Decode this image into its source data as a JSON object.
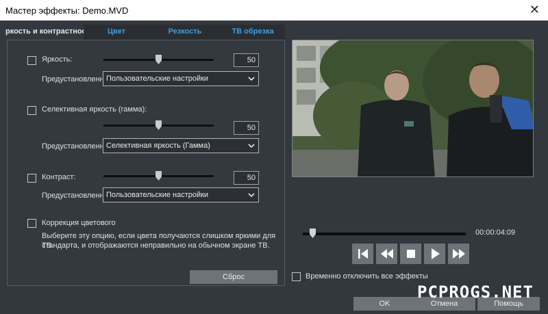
{
  "window": {
    "title": "Мастер эффекты: Demo.MVD",
    "close_glyph": "✕"
  },
  "tabs": [
    {
      "label": "ркость и контрастнос",
      "active": true
    },
    {
      "label": "Цвет"
    },
    {
      "label": "Резкость"
    },
    {
      "label": "ТВ обрезка"
    }
  ],
  "brightness": {
    "label": "Яркость:",
    "checked": false,
    "value": "50",
    "slider_value": 50,
    "preset_label": "Предустановленна",
    "preset_value": "Пользовательские настройки"
  },
  "gamma": {
    "label": "Селективная яркость (гамма):",
    "checked": false,
    "value": "50",
    "slider_value": 50,
    "preset_label": "Предустановленна",
    "preset_value": "Селективная яркость (Гамма)"
  },
  "contrast": {
    "label": "Контраст:",
    "checked": false,
    "value": "50",
    "slider_value": 50,
    "preset_label": "Предустановленна",
    "preset_value": "Пользовательские настройки"
  },
  "color_correction": {
    "label": "Коррекция цветового",
    "checked": false,
    "description_line1": "Выберите эту опцию, если цвета получаются слишком яркими для ТВ",
    "description_line2": "стандарта, и отображаются неправильно на обычном экране ТВ."
  },
  "reset_button": "Сброс",
  "player": {
    "timecode": "00:00:04:09",
    "controls": [
      "skip-to-start-icon",
      "rewind-icon",
      "stop-icon",
      "play-icon",
      "fast-forward-icon"
    ]
  },
  "disable_effects": {
    "label": "Временно отключить все эффекты",
    "checked": false
  },
  "footer": {
    "ok": "OK",
    "cancel": "Отмена",
    "help": "Помощь"
  },
  "watermark": "PCPROGS.NET",
  "colors": {
    "background": "#33383e",
    "tab_text": "#3d9de0",
    "button": "#6e7377"
  }
}
